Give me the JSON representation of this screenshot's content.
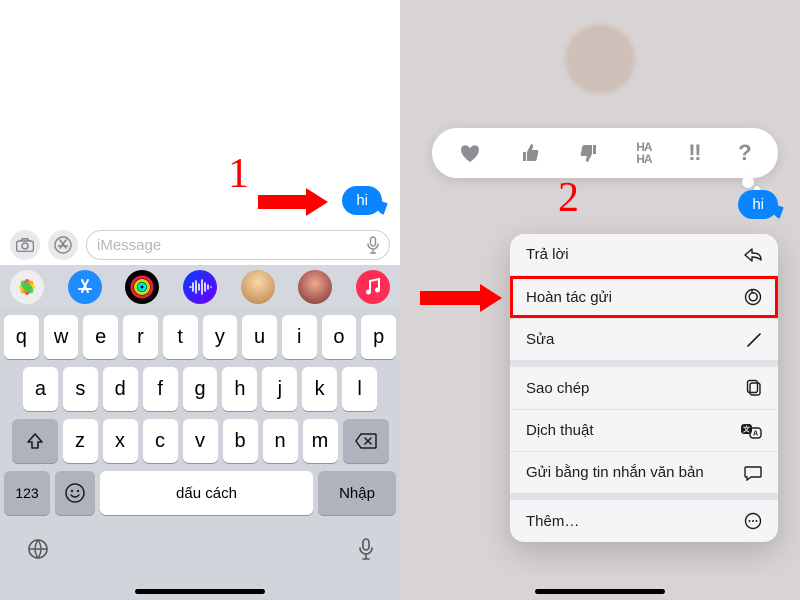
{
  "annotations": {
    "step1": "1",
    "step2": "2"
  },
  "left": {
    "message": "hi",
    "compose": {
      "placeholder": "iMessage",
      "camera_icon": "camera-icon",
      "appstore_icon": "appstore-icon",
      "mic_icon": "mic-icon"
    },
    "app_strip": [
      {
        "name": "photos-app-icon",
        "color": "#ffffff"
      },
      {
        "name": "appstore-app-icon",
        "color": "#1f8bff"
      },
      {
        "name": "activity-app-icon",
        "color": "#000000"
      },
      {
        "name": "audio-app-icon",
        "color": "#0a3cff"
      },
      {
        "name": "memoji-app-icon",
        "color": "#f2b36a"
      },
      {
        "name": "animoji-app-icon",
        "color": "#d8605f"
      },
      {
        "name": "music-app-icon",
        "color": "#ff2d55"
      }
    ],
    "keyboard": {
      "row1": [
        "q",
        "w",
        "e",
        "r",
        "t",
        "y",
        "u",
        "i",
        "o",
        "p"
      ],
      "row2": [
        "a",
        "s",
        "d",
        "f",
        "g",
        "h",
        "j",
        "k",
        "l"
      ],
      "row3": [
        "z",
        "x",
        "c",
        "v",
        "b",
        "n",
        "m"
      ],
      "numbers": "123",
      "space": "dấu cách",
      "return": "Nhập"
    }
  },
  "right": {
    "message": "hi",
    "reactions": [
      {
        "name": "heart-reaction",
        "glyph": "♥"
      },
      {
        "name": "thumbs-up-reaction",
        "glyph": "👍"
      },
      {
        "name": "thumbs-down-reaction",
        "glyph": "👎"
      },
      {
        "name": "haha-reaction",
        "glyph": "HA\nHA"
      },
      {
        "name": "exclaim-reaction",
        "glyph": "!!"
      },
      {
        "name": "question-reaction",
        "glyph": "?"
      }
    ],
    "menu": {
      "reply": {
        "label": "Trả lời",
        "icon": "reply-icon"
      },
      "undo": {
        "label": "Hoàn tác gửi",
        "icon": "undo-send-icon"
      },
      "edit": {
        "label": "Sửa",
        "icon": "edit-icon"
      },
      "copy": {
        "label": "Sao chép",
        "icon": "copy-icon"
      },
      "translate": {
        "label": "Dịch thuật",
        "icon": "translate-icon"
      },
      "sendsms": {
        "label": "Gửi bằng tin nhắn văn bản",
        "icon": "send-sms-icon"
      },
      "more": {
        "label": "Thêm…",
        "icon": "more-icon"
      }
    }
  }
}
